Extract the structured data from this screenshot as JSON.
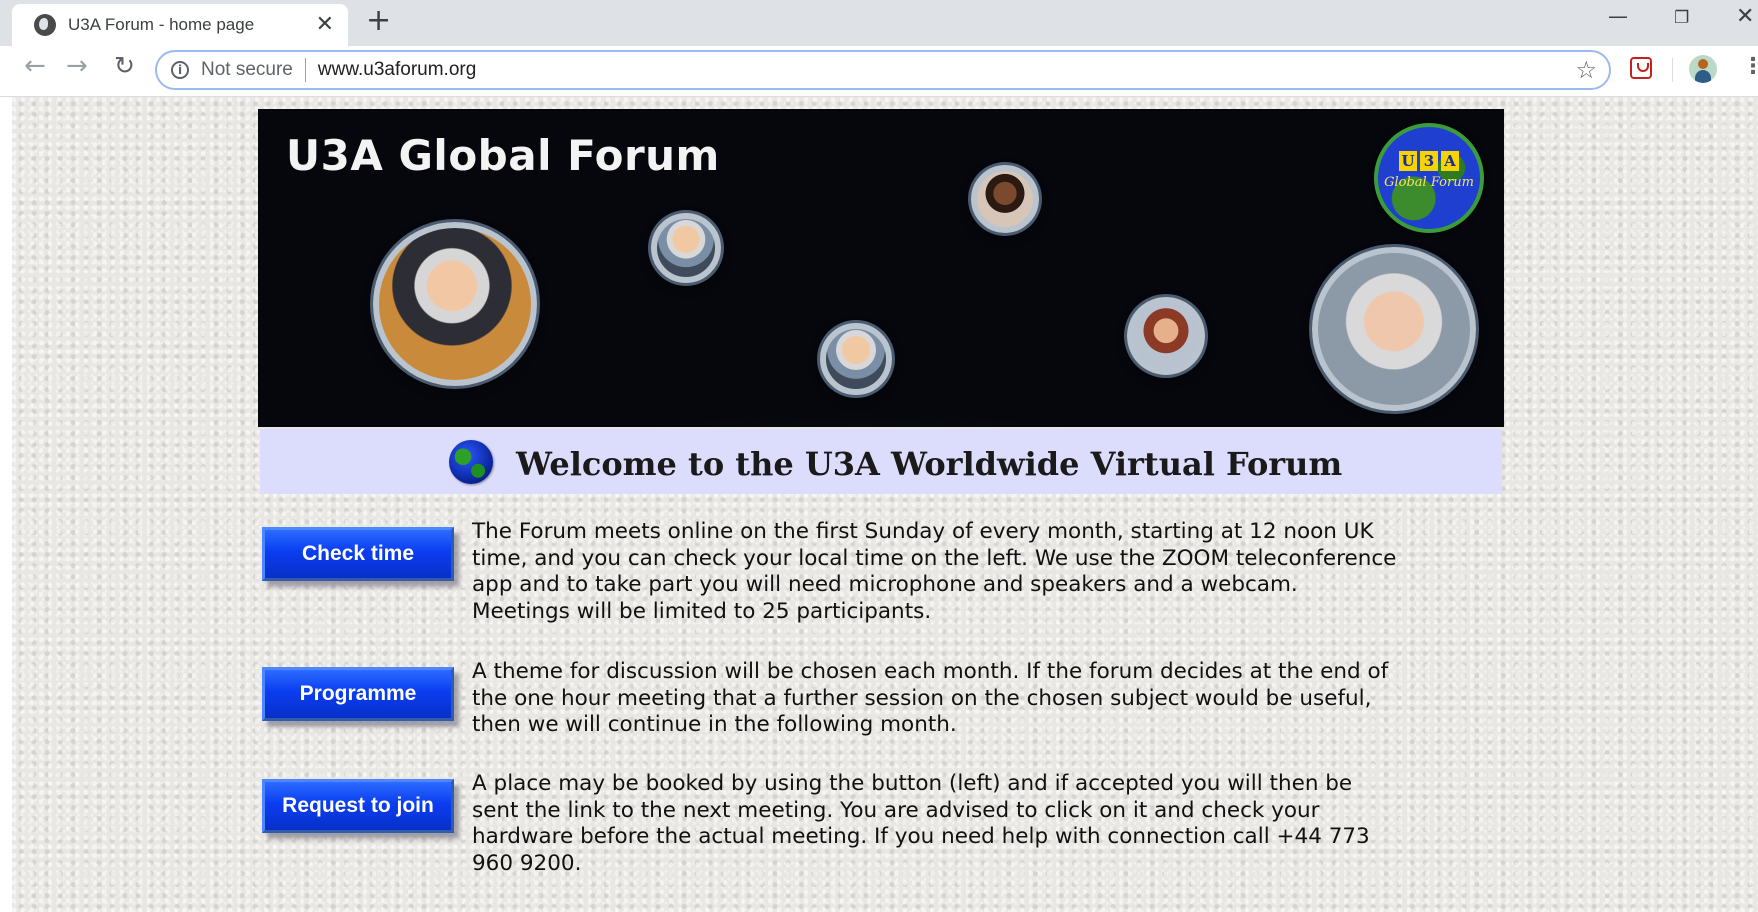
{
  "browser": {
    "tab_title": "U3A Forum - home page",
    "tab_close": "✕",
    "new_tab": "+",
    "security_label": "Not secure",
    "url": "www.u3aforum.org",
    "window_minimize": "—",
    "window_restore": "❐",
    "window_close": "✕",
    "icons": [
      "globe-favicon",
      "back-arrow",
      "forward-arrow",
      "reload",
      "info",
      "star",
      "extension-pocket",
      "profile-avatar",
      "kebab-menu"
    ]
  },
  "banner": {
    "title": "U3A Global Forum",
    "logo_letters": [
      "U",
      "3",
      "A"
    ],
    "logo_tagline": "Global Forum"
  },
  "welcome": {
    "title": "Welcome to the U3A Worldwide Virtual Forum"
  },
  "rows": [
    {
      "button": "Check time",
      "text": "The Forum meets online on the first Sunday of every month, starting at 12 noon UK time, and you can check your local time on the left. We use the ZOOM teleconference app and to take part you will need microphone and speakers and a webcam. Meetings will be limited to 25 participants."
    },
    {
      "button": "Programme",
      "text": "A theme for discussion will be chosen each month. If the forum decides at the end of the one hour meeting that a further session on the chosen subject would be useful, then we will continue in the following month."
    },
    {
      "button": "Request to join",
      "text": "A place may be booked by using the button (left) and if accepted you will then be sent the link to the next meeting. You are advised to click on it and check your hardware before the actual meeting. If you need help with connection call +44 773 960 9200."
    }
  ],
  "colors": {
    "button_blue": "#0b3df0",
    "welcome_bar": "#dcdcfc",
    "page_background": "#e9e7e3"
  }
}
